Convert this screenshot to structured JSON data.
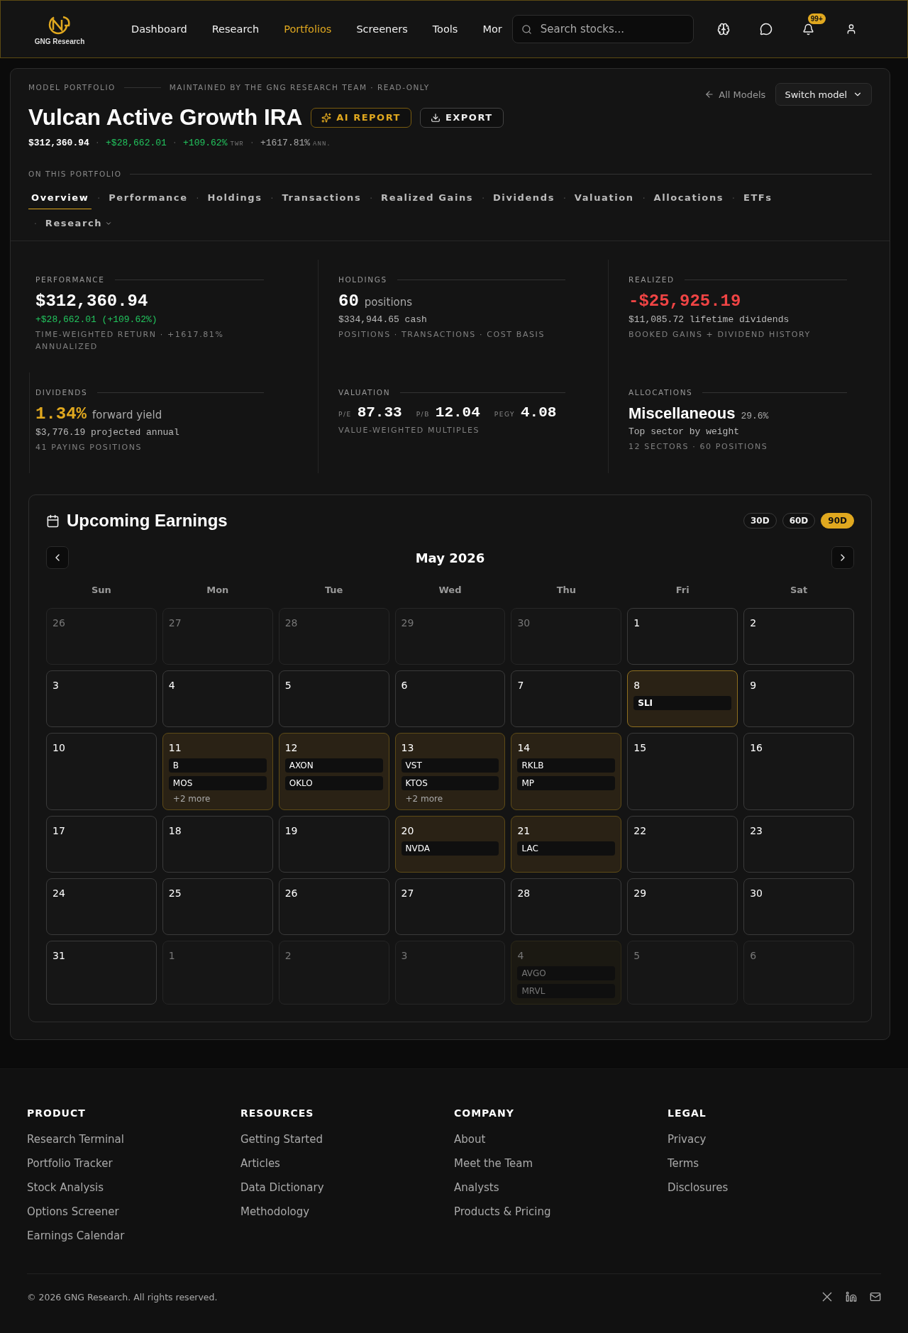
{
  "header": {
    "brand": "GNG Research",
    "nav": [
      {
        "label": "Dashboard",
        "selected": false
      },
      {
        "label": "Research",
        "selected": false
      },
      {
        "label": "Portfolios",
        "selected": true
      },
      {
        "label": "Screeners",
        "selected": false
      },
      {
        "label": "Tools",
        "selected": false
      },
      {
        "label": "Mor",
        "selected": false
      }
    ],
    "search": {
      "placeholder": "Search stocks..."
    },
    "notification_badge": "99+"
  },
  "portfolio": {
    "eyebrow": "MODEL PORTFOLIO",
    "maintainer": "MAINTAINED BY THE GNG RESEARCH TEAM · READ-ONLY",
    "title": "Vulcan Active Growth IRA",
    "ai_report": "AI REPORT",
    "export": "EXPORT",
    "back_link": "All Models",
    "switch_model": "Switch model",
    "summary": {
      "value": "$312,360.94",
      "gain": "+$28,662.01",
      "twr": "+109.62%",
      "twr_label": "TWR",
      "annualized": "+1617.81%",
      "annualized_label": "ANN.",
      "separators": [
        "·",
        "·",
        "·"
      ]
    },
    "section_label": "ON THIS PORTFOLIO",
    "tabs": [
      {
        "label": "Overview",
        "selected": true,
        "dropdown": false
      },
      {
        "separator": "·",
        "label": "Performance",
        "selected": false,
        "dropdown": false
      },
      {
        "separator": "·",
        "label": "Holdings",
        "selected": false,
        "dropdown": false
      },
      {
        "separator": "·",
        "label": "Transactions",
        "selected": false,
        "dropdown": false
      },
      {
        "separator": "·",
        "label": "Realized Gains",
        "selected": false,
        "dropdown": false
      },
      {
        "separator": "·",
        "label": "Dividends",
        "selected": false,
        "dropdown": false
      },
      {
        "separator": "·",
        "label": "Valuation",
        "selected": false,
        "dropdown": false
      },
      {
        "separator": "·",
        "label": "Allocations",
        "selected": false,
        "dropdown": false
      },
      {
        "separator": "·",
        "label": "ETFs",
        "selected": false,
        "dropdown": false
      },
      {
        "separator": "·",
        "label": "Research",
        "selected": false,
        "dropdown": true
      }
    ]
  },
  "stats": [
    {
      "kind": "figure",
      "label": "PERFORMANCE",
      "value": "$312,360.94",
      "color": "#ffffff",
      "sub": "+$28,662.01 (+109.62%)",
      "sub_gain": true,
      "note": "TIME-WEIGHTED RETURN · +1617.81% ANNUALIZED"
    },
    {
      "kind": "figure",
      "label": "HOLDINGS",
      "value": "60",
      "unit": "positions",
      "color": "#ffffff",
      "sub": "$334,944.65 cash",
      "sub_gain": false,
      "note": "POSITIONS · TRANSACTIONS · COST BASIS"
    },
    {
      "kind": "figure",
      "label": "REALIZED",
      "value": "-$25,925.19",
      "color": "#ef4444",
      "sub": "$11,085.72 lifetime dividends",
      "sub_gain": false,
      "note": "BOOKED GAINS + DIVIDEND HISTORY"
    },
    {
      "kind": "figure",
      "label": "DIVIDENDS",
      "value": "1.34%",
      "unit": "forward yield",
      "color": "#e0a81f",
      "sub": "$3,776.19 projected annual",
      "sub_gain": false,
      "note": "41 PAYING POSITIONS"
    },
    {
      "kind": "multiples",
      "label": "VALUATION",
      "metrics": [
        {
          "label": "P/E",
          "value": "87.33"
        },
        {
          "label": "P/B",
          "value": "12.04"
        },
        {
          "label": "PEGY",
          "value": "4.08"
        }
      ],
      "note": "VALUE-WEIGHTED MULTIPLES"
    },
    {
      "kind": "sector",
      "label": "ALLOCATIONS",
      "value": "Miscellaneous",
      "unit": "29.6%",
      "color": "#ffffff",
      "sub": "Top sector by weight",
      "sub_gain": false,
      "note": "12 SECTORS · 60 POSITIONS"
    }
  ],
  "earnings": {
    "title": "Upcoming Earnings",
    "ranges": [
      {
        "label": "30D",
        "selected": false
      },
      {
        "label": "60D",
        "selected": false
      },
      {
        "label": "90D",
        "selected": true
      }
    ],
    "month": "May 2026",
    "weekdays": [
      "Sun",
      "Mon",
      "Tue",
      "Wed",
      "Thu",
      "Fri",
      "Sat"
    ],
    "weeks": [
      [
        {
          "day": "26",
          "in_month": false,
          "today": false
        },
        {
          "day": "27",
          "in_month": false,
          "today": false
        },
        {
          "day": "28",
          "in_month": false,
          "today": false
        },
        {
          "day": "29",
          "in_month": false,
          "today": false
        },
        {
          "day": "30",
          "in_month": false,
          "today": false
        },
        {
          "day": "1",
          "in_month": true,
          "today": false
        },
        {
          "day": "2",
          "in_month": true,
          "today": false
        }
      ],
      [
        {
          "day": "3",
          "in_month": true,
          "today": false
        },
        {
          "day": "4",
          "in_month": true,
          "today": false
        },
        {
          "day": "5",
          "in_month": true,
          "today": false
        },
        {
          "day": "6",
          "in_month": true,
          "today": false
        },
        {
          "day": "7",
          "in_month": true,
          "today": false
        },
        {
          "day": "8",
          "in_month": true,
          "today": true,
          "tickers": [
            "SLI"
          ]
        },
        {
          "day": "9",
          "in_month": true,
          "today": false
        }
      ],
      [
        {
          "day": "10",
          "in_month": true,
          "today": false
        },
        {
          "day": "11",
          "in_month": true,
          "today": false,
          "tickers": [
            "B",
            "MOS"
          ],
          "more": "+2 more"
        },
        {
          "day": "12",
          "in_month": true,
          "today": false,
          "tickers": [
            "AXON",
            "OKLO"
          ]
        },
        {
          "day": "13",
          "in_month": true,
          "today": false,
          "tickers": [
            "VST",
            "KTOS"
          ],
          "more": "+2 more"
        },
        {
          "day": "14",
          "in_month": true,
          "today": false,
          "tickers": [
            "RKLB",
            "MP"
          ]
        },
        {
          "day": "15",
          "in_month": true,
          "today": false
        },
        {
          "day": "16",
          "in_month": true,
          "today": false
        }
      ],
      [
        {
          "day": "17",
          "in_month": true,
          "today": false
        },
        {
          "day": "18",
          "in_month": true,
          "today": false
        },
        {
          "day": "19",
          "in_month": true,
          "today": false
        },
        {
          "day": "20",
          "in_month": true,
          "today": false,
          "tickers": [
            "NVDA"
          ]
        },
        {
          "day": "21",
          "in_month": true,
          "today": false,
          "tickers": [
            "LAC"
          ]
        },
        {
          "day": "22",
          "in_month": true,
          "today": false
        },
        {
          "day": "23",
          "in_month": true,
          "today": false
        }
      ],
      [
        {
          "day": "24",
          "in_month": true,
          "today": false
        },
        {
          "day": "25",
          "in_month": true,
          "today": false
        },
        {
          "day": "26",
          "in_month": true,
          "today": false
        },
        {
          "day": "27",
          "in_month": true,
          "today": false
        },
        {
          "day": "28",
          "in_month": true,
          "today": false
        },
        {
          "day": "29",
          "in_month": true,
          "today": false
        },
        {
          "day": "30",
          "in_month": true,
          "today": false
        }
      ],
      [
        {
          "day": "31",
          "in_month": true,
          "today": false
        },
        {
          "day": "1",
          "in_month": false,
          "today": false
        },
        {
          "day": "2",
          "in_month": false,
          "today": false
        },
        {
          "day": "3",
          "in_month": false,
          "today": false
        },
        {
          "day": "4",
          "in_month": false,
          "today": false,
          "tickers": [
            "AVGO",
            "MRVL"
          ]
        },
        {
          "day": "5",
          "in_month": false,
          "today": false
        },
        {
          "day": "6",
          "in_month": false,
          "today": false
        }
      ]
    ]
  },
  "footer": {
    "columns": [
      {
        "heading": "PRODUCT",
        "links": [
          "Research Terminal",
          "Portfolio Tracker",
          "Stock Analysis",
          "Options Screener",
          "Earnings Calendar"
        ]
      },
      {
        "heading": "RESOURCES",
        "links": [
          "Getting Started",
          "Articles",
          "Data Dictionary",
          "Methodology"
        ]
      },
      {
        "heading": "COMPANY",
        "links": [
          "About",
          "Meet the Team",
          "Analysts",
          "Products & Pricing"
        ]
      },
      {
        "heading": "LEGAL",
        "links": [
          "Privacy",
          "Terms",
          "Disclosures"
        ]
      }
    ],
    "copyright": "© 2026 GNG Research. All rights reserved."
  }
}
